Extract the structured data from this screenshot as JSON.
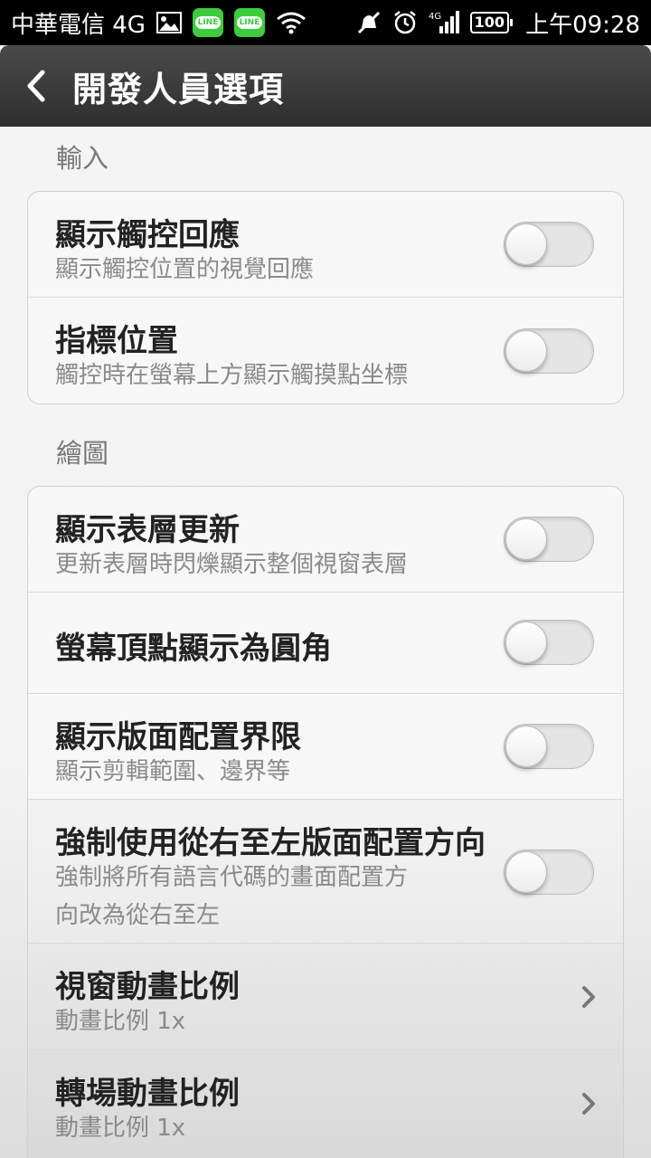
{
  "status_bar": {
    "carrier": "中華電信 4G",
    "time": "上午09:28",
    "battery": "100",
    "network_badge": "4G",
    "icons": [
      "image-icon",
      "line-app-icon",
      "line-app-icon",
      "wifi-icon",
      "mute-icon",
      "alarm-icon",
      "signal-icon",
      "battery-icon"
    ]
  },
  "header": {
    "title": "開發人員選項",
    "back_icon": "chevron-left-icon"
  },
  "sections": {
    "input": {
      "header": "輸入",
      "rows": [
        {
          "title": "顯示觸控回應",
          "subtitle": "顯示觸控位置的視覺回應",
          "toggle": false
        },
        {
          "title": "指標位置",
          "subtitle": "觸控時在螢幕上方顯示觸摸點坐標",
          "toggle": false
        }
      ]
    },
    "drawing": {
      "header": "繪圖",
      "rows": [
        {
          "title": "顯示表層更新",
          "subtitle": "更新表層時閃爍顯示整個視窗表層",
          "toggle": false
        },
        {
          "title": "螢幕頂點顯示為圓角",
          "toggle": false
        },
        {
          "title": "顯示版面配置界限",
          "subtitle": "顯示剪輯範圍、邊界等",
          "toggle": false
        },
        {
          "title": "強制使用從右至左版面配置方向",
          "subtitle_line1": "強制將所有語言代碼的畫面配置方",
          "subtitle_line2": "向改為從右至左",
          "toggle": false
        },
        {
          "title": "視窗動畫比例",
          "subtitle": "動畫比例 1x"
        },
        {
          "title": "轉場動畫比例",
          "subtitle": "動畫比例 1x"
        }
      ]
    }
  },
  "colors": {
    "title_bar": "#3a3a3a",
    "background": "#f3f3f3",
    "line_green": "#3ccc3c"
  }
}
